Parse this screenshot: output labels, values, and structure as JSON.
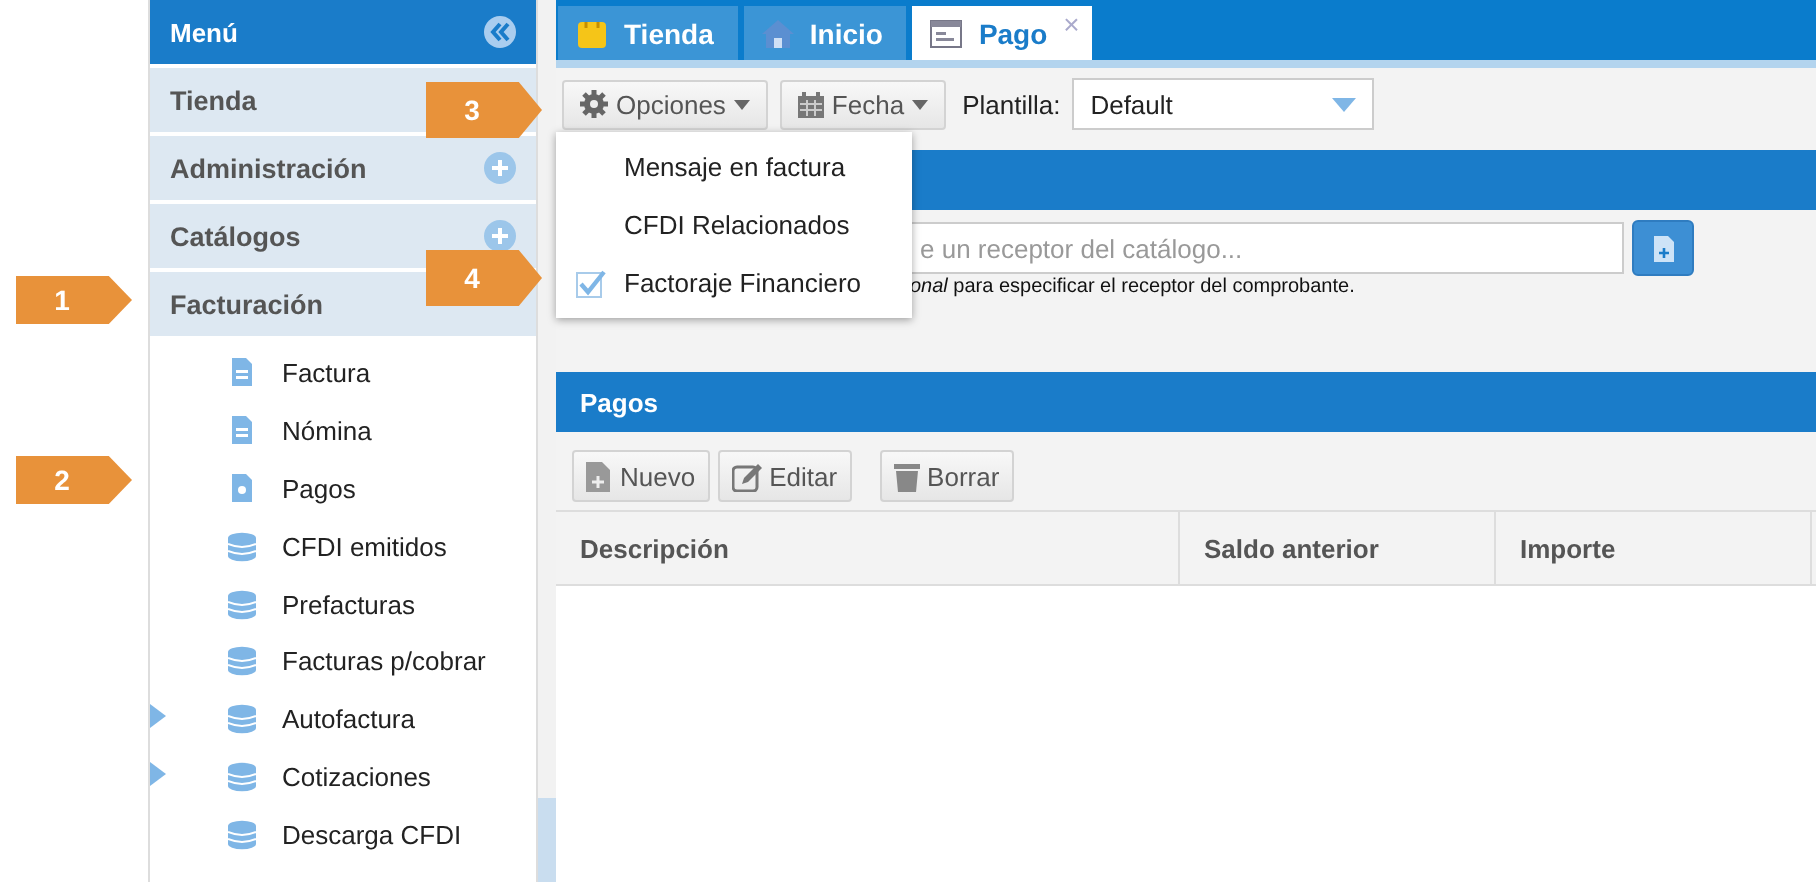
{
  "sidebar": {
    "title": "Menú",
    "sections": [
      {
        "label": "Tienda"
      },
      {
        "label": "Administración",
        "expanded": false
      },
      {
        "label": "Catálogos",
        "expanded": false
      },
      {
        "label": "Facturación"
      }
    ],
    "items": [
      {
        "label": "Factura",
        "kind": "document",
        "expandable": false
      },
      {
        "label": "Nómina",
        "kind": "document",
        "expandable": false
      },
      {
        "label": "Pagos",
        "kind": "payment",
        "expandable": false
      },
      {
        "label": "CFDI emitidos",
        "kind": "database",
        "expandable": false
      },
      {
        "label": "Prefacturas",
        "kind": "database",
        "expandable": false
      },
      {
        "label": "Facturas p/cobrar",
        "kind": "database",
        "expandable": false
      },
      {
        "label": "Autofactura",
        "kind": "database",
        "expandable": true
      },
      {
        "label": "Cotizaciones",
        "kind": "database",
        "expandable": true
      },
      {
        "label": "Descarga CFDI",
        "kind": "database",
        "expandable": false
      }
    ]
  },
  "tabs": [
    {
      "label": "Tienda",
      "kind": "store",
      "selected": false
    },
    {
      "label": "Inicio",
      "kind": "home",
      "selected": false
    },
    {
      "label": "Pago",
      "kind": "form",
      "selected": true,
      "close": "×"
    }
  ],
  "toolbar": {
    "options_button": "Opciones",
    "date_button": "Fecha",
    "template_label": "Plantilla:",
    "template_value": "Default"
  },
  "options_menu": [
    {
      "label": "Mensaje en factura",
      "checked": false
    },
    {
      "label": "CFDI Relacionados",
      "checked": false
    },
    {
      "label": "Factoraje Financiero",
      "checked": true
    }
  ],
  "receiver_panel": {
    "placeholder": "e un receptor del catálogo...",
    "hint": "*onal* para especificar el receptor del comprobante."
  },
  "payments_panel": {
    "title": "Pagos",
    "buttons": [
      "Nuevo",
      "Editar",
      "Borrar"
    ],
    "columns": [
      "Descripción",
      "Saldo anterior",
      "Importe"
    ]
  },
  "callouts": [
    {
      "number": "1"
    },
    {
      "number": "2"
    },
    {
      "number": "3"
    },
    {
      "number": "4"
    }
  ]
}
